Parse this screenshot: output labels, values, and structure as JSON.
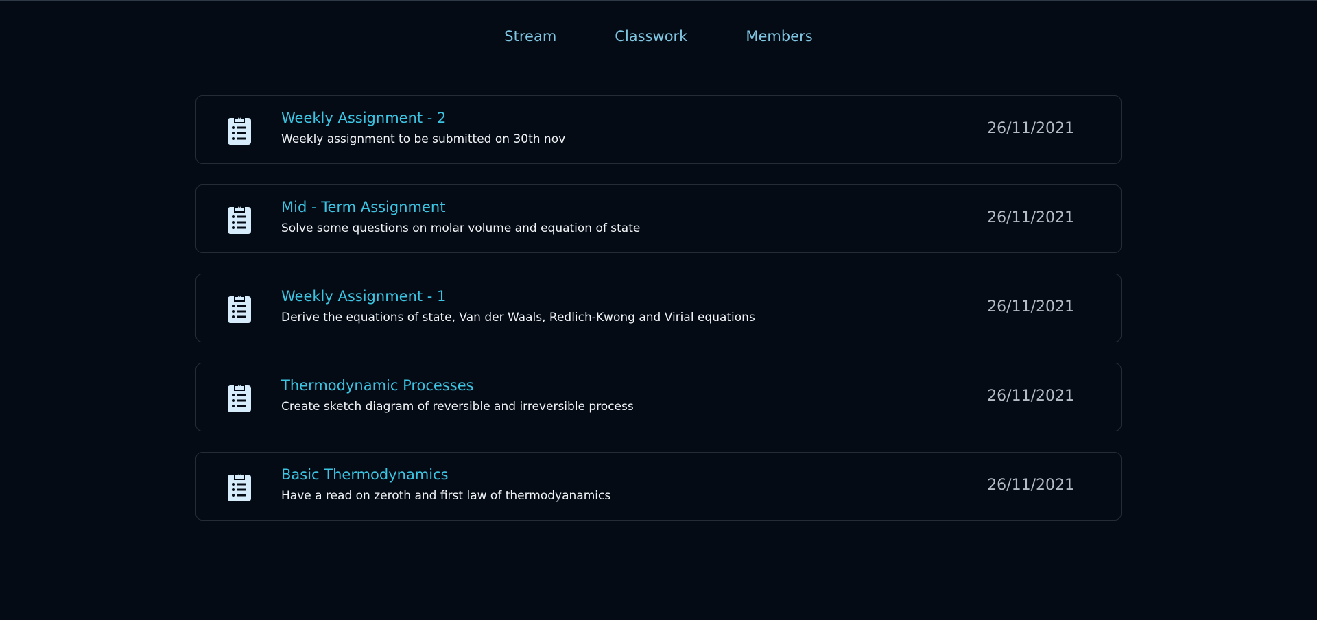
{
  "nav": {
    "tabs": [
      {
        "label": "Stream"
      },
      {
        "label": "Classwork"
      },
      {
        "label": "Members"
      }
    ]
  },
  "assignments": [
    {
      "title": "Weekly Assignment - 2",
      "description": "Weekly assignment to be submitted on 30th nov",
      "date": "26/11/2021"
    },
    {
      "title": "Mid - Term Assignment",
      "description": "Solve some questions on molar volume and equation of state",
      "date": "26/11/2021"
    },
    {
      "title": "Weekly Assignment - 1",
      "description": "Derive the equations of state, Van der Waals, Redlich-Kwong and Virial equations",
      "date": "26/11/2021"
    },
    {
      "title": "Thermodynamic Processes",
      "description": "Create sketch diagram of reversible and irreversible process",
      "date": "26/11/2021"
    },
    {
      "title": "Basic Thermodynamics",
      "description": "Have a read on zeroth and first law of thermodyanamics",
      "date": "26/11/2021"
    }
  ],
  "icons": {
    "assignment": "clipboard-list-icon"
  },
  "colors": {
    "background": "#040b14",
    "nav_link": "#7fc6e2",
    "title": "#3cc4e3",
    "icon": "#d6ecfb"
  }
}
